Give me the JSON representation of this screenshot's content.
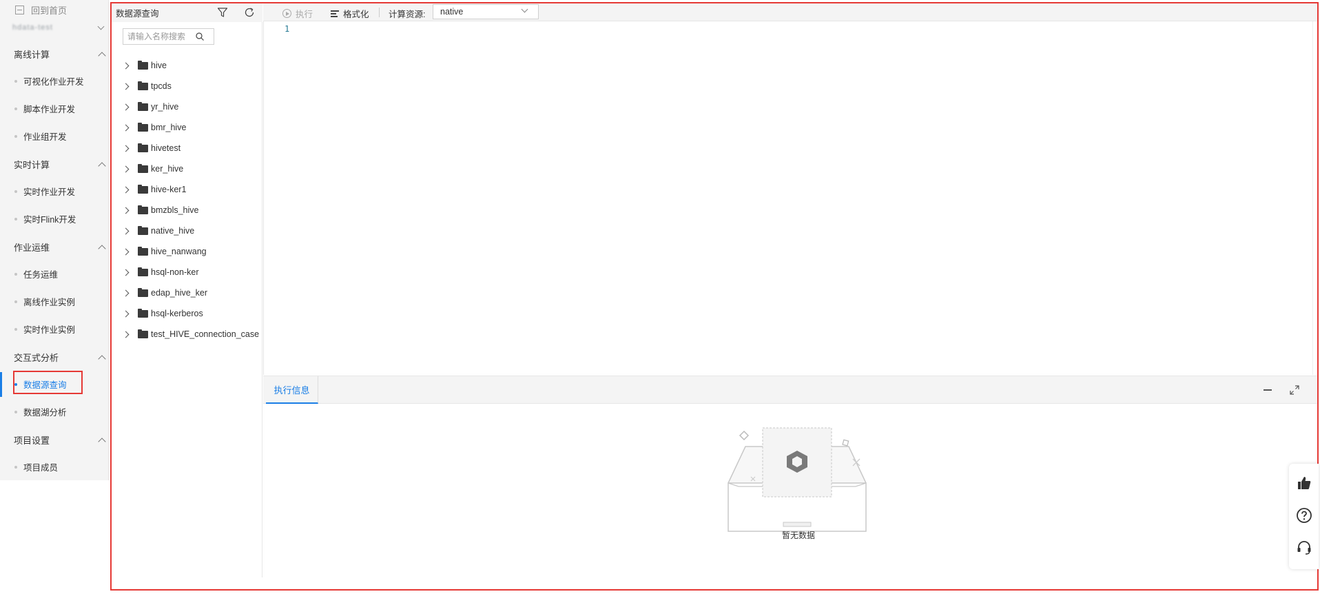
{
  "nav": {
    "home": "回到首页",
    "project": "hdata-test",
    "groups": [
      {
        "label": "离线计算",
        "items": [
          "可视化作业开发",
          "脚本作业开发",
          "作业组开发"
        ]
      },
      {
        "label": "实时计算",
        "items": [
          "实时作业开发",
          "实时Flink开发"
        ]
      },
      {
        "label": "作业运维",
        "items": [
          "任务运维",
          "离线作业实例",
          "实时作业实例"
        ]
      },
      {
        "label": "交互式分析",
        "items": [
          "数据源查询",
          "数据湖分析"
        ]
      },
      {
        "label": "项目设置",
        "items": [
          "项目成员"
        ]
      }
    ],
    "active_item": "数据源查询"
  },
  "datasource": {
    "title": "数据源查询",
    "search_placeholder": "请输入名称搜索",
    "sources": [
      "hive",
      "tpcds",
      "yr_hive",
      "bmr_hive",
      "hivetest",
      "ker_hive",
      "hive-ker1",
      "bmzbls_hive",
      "native_hive",
      "hive_nanwang",
      "hsql-non-ker",
      "edap_hive_ker",
      "hsql-kerberos",
      "test_HIVE_connection_case"
    ]
  },
  "toolbar": {
    "run_label": "执行",
    "format_label": "格式化",
    "resource_label": "计算资源:",
    "resource_value": "native"
  },
  "editor": {
    "line_number": "1"
  },
  "exec_panel": {
    "tab_label": "执行信息",
    "empty_text": "暂无数据"
  },
  "colors": {
    "accent": "#1a7ee6",
    "highlight": "#e53935"
  }
}
